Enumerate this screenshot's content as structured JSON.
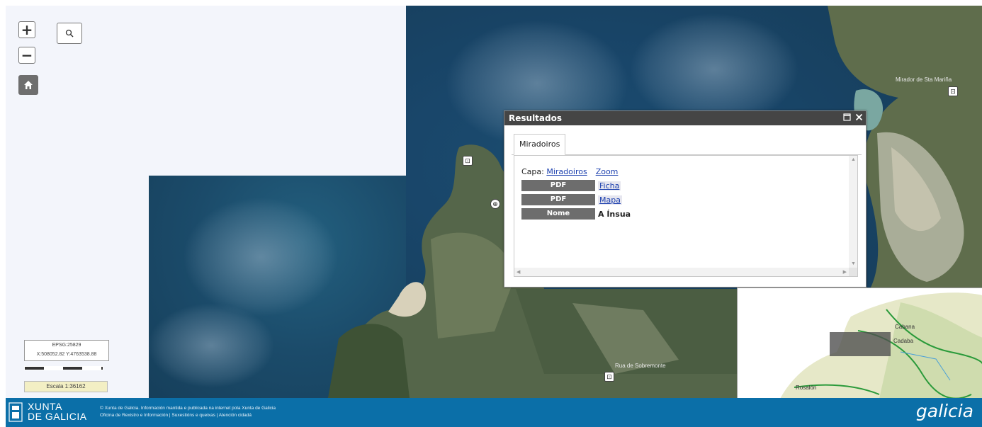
{
  "map": {
    "controls": {
      "zoom_in": "+",
      "zoom_out": "−",
      "search_icon": "search-icon",
      "home_icon": "home-icon"
    },
    "coords": {
      "epsg": "EPSG:25829",
      "value": "X:508052.82 Y:4763538.88"
    },
    "scale_label": "Escala 1:36162",
    "place_labels": [
      "Mirador de Sta Mariña",
      "Rua de Sobremonte",
      "Cabana",
      "Cadaba",
      "Rosalón"
    ]
  },
  "dialog": {
    "title": "Resultados",
    "maximize_icon": "maximize-icon",
    "close_icon": "close-icon",
    "tab": "Miradoiros",
    "capa_label": "Capa:",
    "capa_link": "Miradoiros",
    "zoom_link": "Zoom",
    "rows": [
      {
        "key": "PDF",
        "value": "Ficha",
        "type": "link"
      },
      {
        "key": "PDF",
        "value": "Mapa",
        "type": "link"
      },
      {
        "key": "Nome",
        "value": "A Ínsua",
        "type": "text"
      }
    ]
  },
  "footer": {
    "logo_line1": "XUNTA",
    "logo_line2": "DE GALICIA",
    "line1": "© Xunta de Galicia. Información mantida e publicada na internet pola Xunta de Galicia",
    "line2": "Oficina de Rexistro e Información | Suxestións e queixas | Atención cidadá",
    "brand": "galicia"
  },
  "colors": {
    "footer_bg": "#0b6fa8",
    "dialog_header": "#454545",
    "key_cell": "#6d6d6d"
  }
}
